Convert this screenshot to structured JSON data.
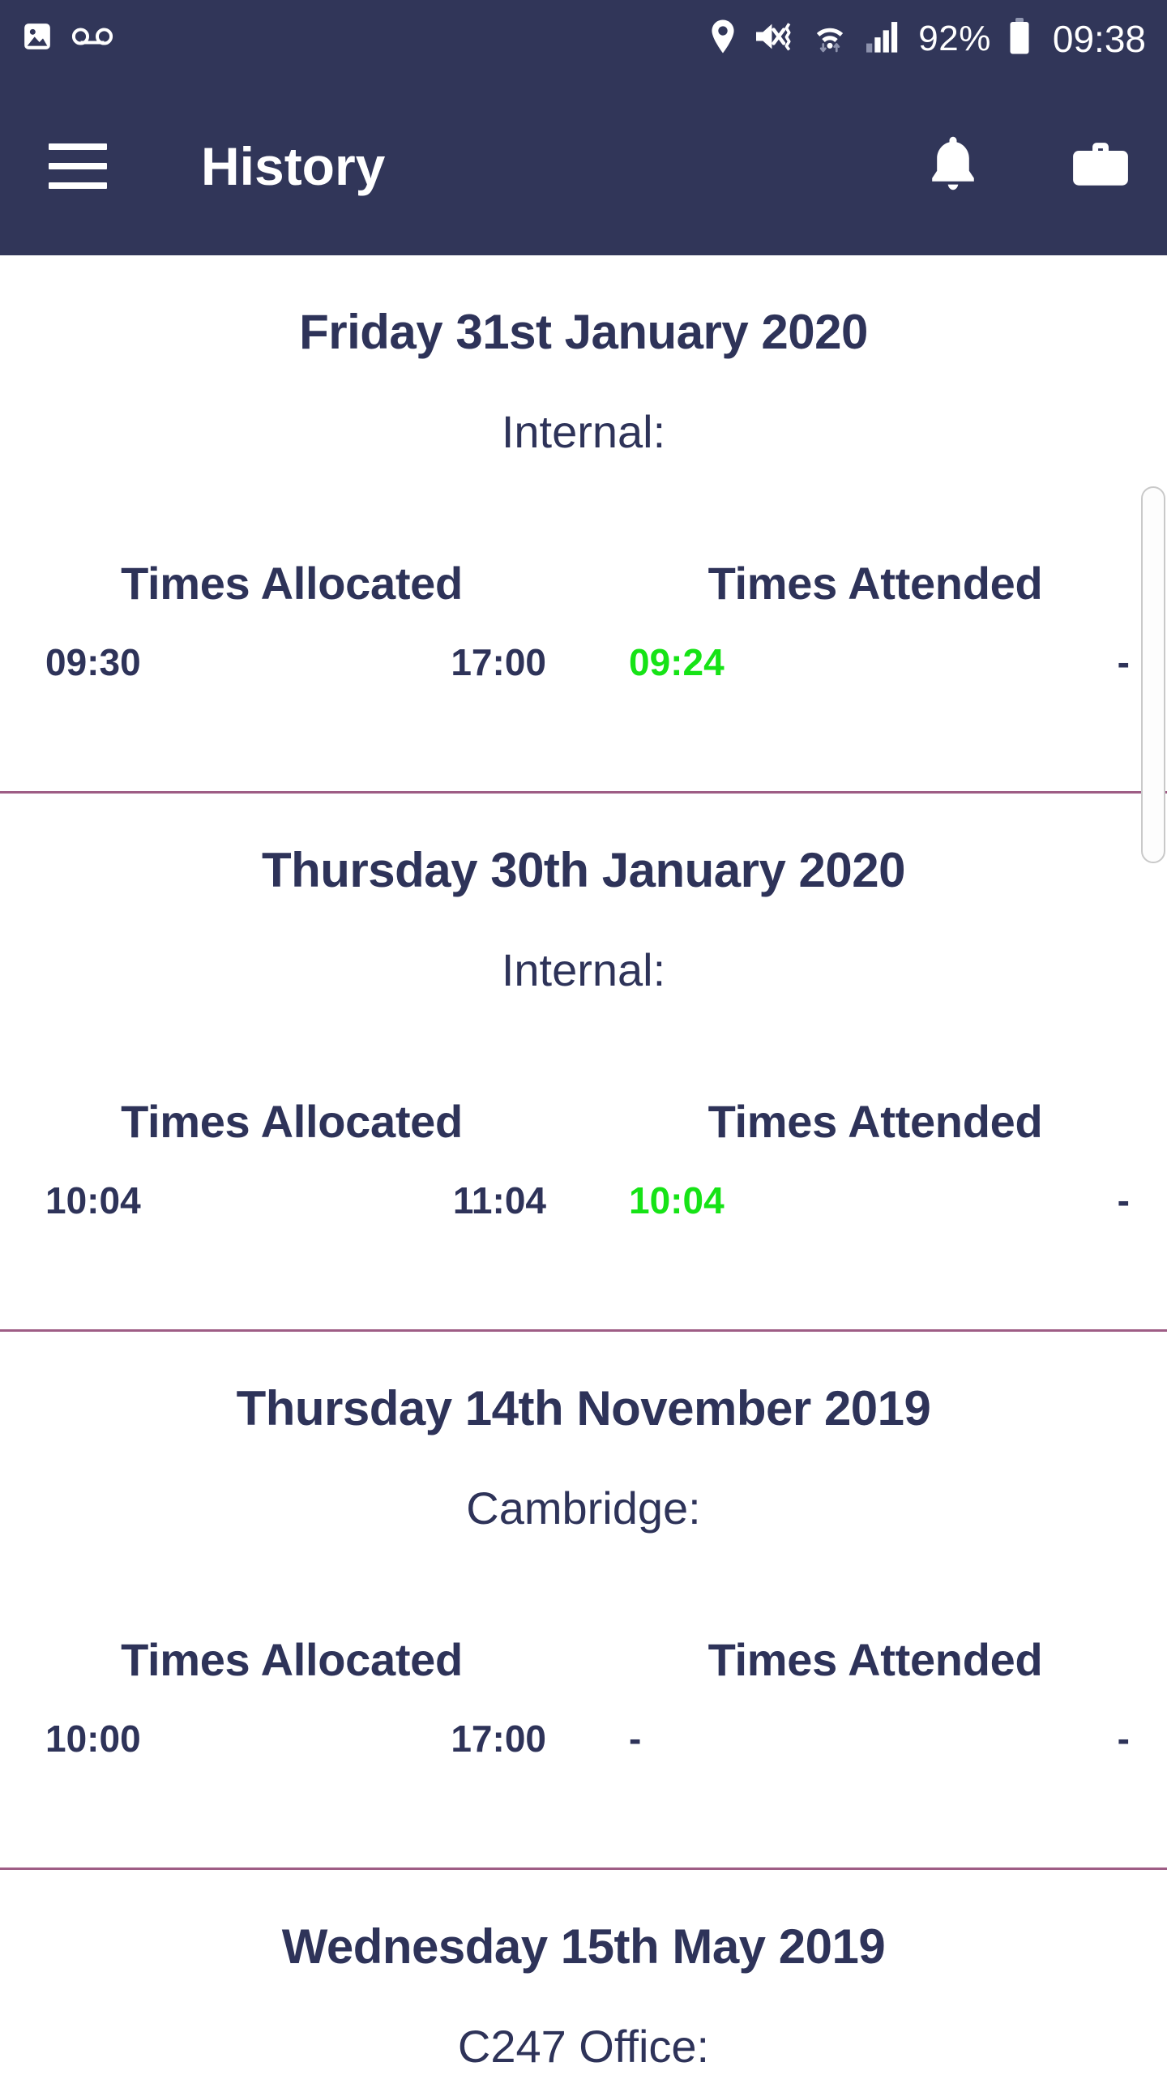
{
  "status_bar": {
    "left_icons": [
      "image-icon",
      "voicemail-icon"
    ],
    "right_icons": [
      "location-pin-icon",
      "volume-mute-vibrate-icon",
      "wifi-icon",
      "cellular-signal-icon",
      "battery-icon"
    ],
    "battery_percent": "92%",
    "clock": "09:38"
  },
  "app_bar": {
    "menu_icon": "hamburger-menu-icon",
    "title": "History",
    "actions": [
      "notifications-bell-icon",
      "briefcase-icon"
    ]
  },
  "colors": {
    "header_background": "#313659",
    "primary_text": "#2e3359",
    "attended_green": "#16e316",
    "divider": "#9e5d85",
    "page_background": "#ffffff"
  },
  "columns": {
    "allocated_header": "Times Allocated",
    "attended_header": "Times Attended"
  },
  "history": [
    {
      "date": "Friday 31st January 2020",
      "location": "Internal:",
      "allocated_start": "09:30",
      "allocated_end": "17:00",
      "attended_start": "09:24",
      "attended_end": "-",
      "attended_start_green": true
    },
    {
      "date": "Thursday 30th January 2020",
      "location": "Internal:",
      "allocated_start": "10:04",
      "allocated_end": "11:04",
      "attended_start": "10:04",
      "attended_end": "-",
      "attended_start_green": true
    },
    {
      "date": "Thursday 14th November 2019",
      "location": "Cambridge:",
      "allocated_start": "10:00",
      "allocated_end": "17:00",
      "attended_start": "-",
      "attended_end": "-",
      "attended_start_green": false
    },
    {
      "date": "Wednesday 15th May 2019",
      "location": "C247 Office:",
      "allocated_start": "",
      "allocated_end": "",
      "attended_start": "",
      "attended_end": "",
      "attended_start_green": false
    }
  ]
}
